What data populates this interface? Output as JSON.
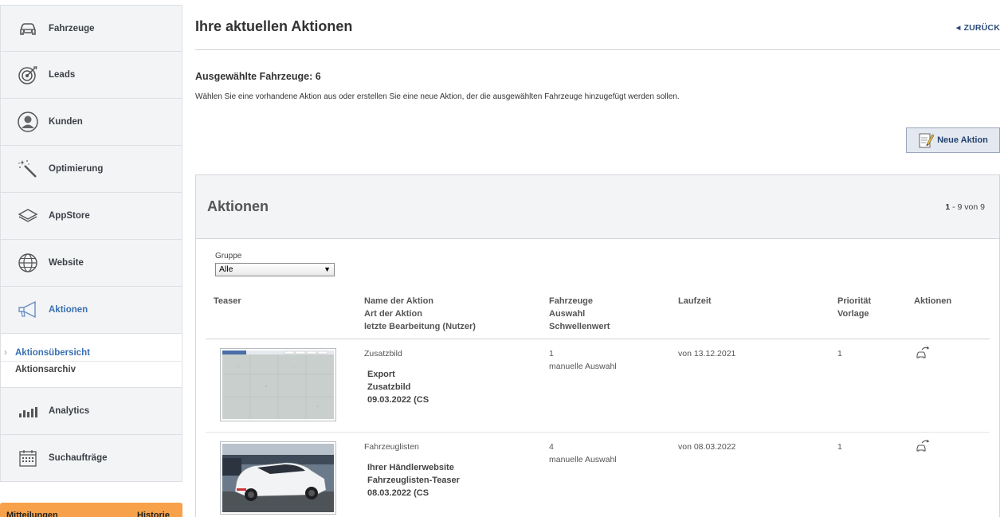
{
  "sidebar": {
    "items": [
      {
        "label": "Fahrzeuge",
        "icon": "car-icon"
      },
      {
        "label": "Leads",
        "icon": "target-icon"
      },
      {
        "label": "Kunden",
        "icon": "user-icon"
      },
      {
        "label": "Optimierung",
        "icon": "magic-wand-icon"
      },
      {
        "label": "AppStore",
        "icon": "layers-icon"
      },
      {
        "label": "Website",
        "icon": "globe-icon"
      },
      {
        "label": "Aktionen",
        "icon": "megaphone-icon"
      }
    ],
    "subitems": [
      {
        "label": "Aktionsübersicht"
      },
      {
        "label": "Aktionsarchiv"
      }
    ],
    "items_after": [
      {
        "label": "Analytics",
        "icon": "bar-chart-icon"
      },
      {
        "label": "Suchaufträge",
        "icon": "calendar-icon"
      }
    ],
    "footer": {
      "left": "Mitteilungen",
      "right": "Historie"
    }
  },
  "header": {
    "title": "Ihre aktuellen Aktionen",
    "back": "ZURÜCK"
  },
  "selection": {
    "label": "Ausgewählte Fahrzeuge: 6",
    "intro": "Wählen Sie eine vorhandene Aktion aus oder erstellen Sie eine neue Aktion, der die ausgewählten Fahrzeuge hinzugefügt werden sollen."
  },
  "new_action_button": "Neue Aktion",
  "panel": {
    "title": "Aktionen",
    "pager_bold": "1",
    "pager_rest": " - 9 von 9",
    "group_label": "Gruppe",
    "group_value": "Alle",
    "columns": {
      "teaser": "Teaser",
      "name": [
        "Name der Aktion",
        "Art der Aktion",
        "letzte Bearbeitung (Nutzer)"
      ],
      "vehicles": [
        "Fahrzeuge",
        "Auswahl",
        "Schwellenwert"
      ],
      "duration": "Laufzeit",
      "priority": [
        "Priorität",
        "Vorlage"
      ],
      "actions": "Aktionen"
    },
    "rows": [
      {
        "type": "Zusatzbild",
        "name": "Export",
        "kind": "Zusatzbild",
        "edited": "09.03.2022 (CS",
        "vehicles": "1",
        "selection": "manuelle Auswahl",
        "duration": "von 13.12.2021",
        "priority": "1"
      },
      {
        "type": "Fahrzeuglisten",
        "name": "Ihrer Händlerwebsite",
        "kind": "Fahrzeuglisten-Teaser",
        "edited": "08.03.2022 (CS",
        "vehicles": "4",
        "selection": "manuelle Auswahl",
        "duration": "von 08.03.2022",
        "priority": "1"
      }
    ]
  },
  "colors": {
    "accent": "#3a6fb0",
    "footer_orange": "#f7a24a",
    "button_bg": "#e3e8f1"
  }
}
